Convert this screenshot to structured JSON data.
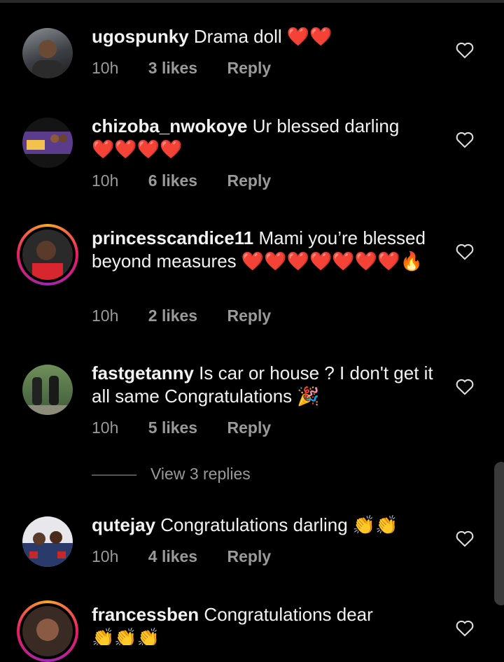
{
  "comments": [
    {
      "username": "ugospunky",
      "text": "Drama doll",
      "emojis": "❤️❤️",
      "time": "10h",
      "likes": "3 likes",
      "reply": "Reply",
      "avatar_icon": "profile-photo"
    },
    {
      "username": "chizoba_nwokoye",
      "text": "Ur blessed darling",
      "emojis": "❤️❤️❤️❤️",
      "time": "10h",
      "likes": "6 likes",
      "reply": "Reply",
      "avatar_icon": "profile-photo"
    },
    {
      "username": "princesscandice11",
      "text": "Mami you’re blessed beyond measures",
      "emojis": "❤️❤️❤️❤️❤️❤️❤️🔥",
      "time": "10h",
      "likes": "2 likes",
      "reply": "Reply",
      "avatar_icon": "profile-photo-story-ring"
    },
    {
      "username": "fastgetanny",
      "text": "Is car or  house ? I don't get it all same Congratulations",
      "emojis": "🎉",
      "time": "10h",
      "likes": "5 likes",
      "reply": "Reply",
      "avatar_icon": "profile-photo"
    },
    {
      "username": "qutejay",
      "text": "Congratulations darling",
      "emojis": "👏👏",
      "time": "10h",
      "likes": "4 likes",
      "reply": "Reply",
      "avatar_icon": "profile-photo"
    },
    {
      "username": "francessben",
      "text": "Congratulations dear",
      "emojis": "👏👏👏",
      "avatar_icon": "profile-photo-story-ring"
    }
  ],
  "view_replies": "View 3 replies",
  "colors": {
    "background": "#000000",
    "text": "#f2f2f2",
    "meta": "#9a9a9a",
    "heart": "#e0132f"
  },
  "icons": {
    "like": "heart-outline-icon"
  }
}
